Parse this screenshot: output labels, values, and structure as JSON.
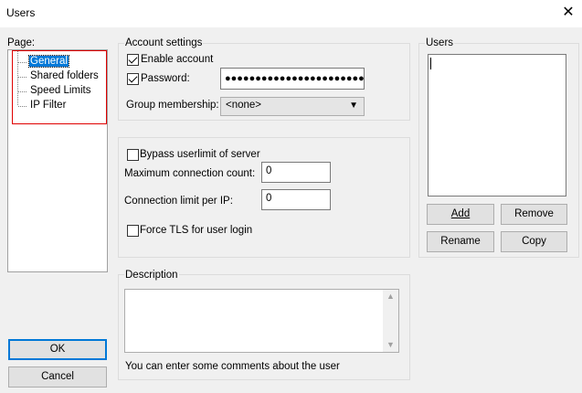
{
  "window": {
    "title": "Users"
  },
  "page_label": "Page:",
  "tree": {
    "items": [
      "General",
      "Shared folders",
      "Speed Limits",
      "IP Filter"
    ]
  },
  "account_settings": {
    "title": "Account settings",
    "enable_account_label": "Enable account",
    "enable_account_checked": true,
    "password_label": "Password:",
    "password_checked": true,
    "password_value": "●●●●●●●●●●●●●●●●●●●●●●●●●●",
    "group_membership_label": "Group membership:",
    "group_membership_value": "<none>"
  },
  "limits": {
    "bypass_label": "Bypass userlimit of server",
    "max_conn_label": "Maximum connection count:",
    "max_conn_value": "0",
    "conn_limit_ip_label": "Connection limit per IP:",
    "conn_limit_ip_value": "0",
    "force_tls_label": "Force TLS for user login"
  },
  "description": {
    "title": "Description",
    "hint": "You can enter some comments about the user"
  },
  "users": {
    "title": "Users",
    "add_label": "Add",
    "remove_label": "Remove",
    "rename_label": "Rename",
    "copy_label": "Copy"
  },
  "dialog": {
    "ok_label": "OK",
    "cancel_label": "Cancel"
  },
  "icons": {
    "close": "close-icon",
    "dropdown": "chevron-down-icon"
  },
  "colors": {
    "selection": "#0078d7",
    "highlight_box": "#e00000"
  }
}
